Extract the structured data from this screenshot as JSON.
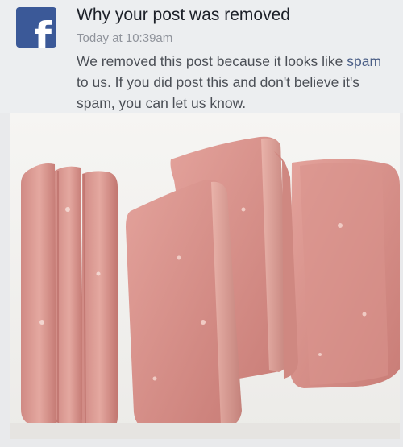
{
  "notification": {
    "title": "Why your post was removed",
    "timestamp": "Today at 10:39am",
    "message_before": "We removed this post because it looks like ",
    "message_link": "spam",
    "message_after": " to us. If you did post this and don't believe it's spam, you can let us know."
  },
  "icons": {
    "app_logo": "facebook-icon",
    "logo_letter": "f"
  },
  "colors": {
    "brand": "#3b5998",
    "link": "#4a5e86",
    "meat": "#d8938c"
  }
}
